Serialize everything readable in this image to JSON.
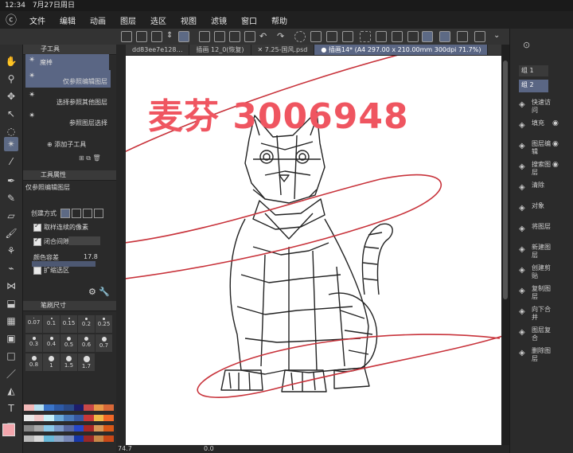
{
  "status": {
    "time": "12:34",
    "date": "7月27日周日"
  },
  "menu": {
    "items": [
      "文件",
      "编辑",
      "动画",
      "图层",
      "选区",
      "视图",
      "滤镜",
      "窗口",
      "帮助"
    ]
  },
  "tabs": [
    {
      "label": "dd83ee7e128…"
    },
    {
      "label": "插画 12_0(恢复)"
    },
    {
      "label": "✕ 7.25-国风.psd"
    },
    {
      "label": "● 插画14* (A4 297.00 x 210.00mm 300dpi 71.7%)",
      "active": true
    }
  ],
  "subtool": {
    "panel_title": "子工具",
    "items": [
      {
        "name": "魔棒",
        "label": ""
      },
      {
        "name": "",
        "label": "仅参照编辑图层"
      },
      {
        "name": "",
        "label": "选择参照其他图层"
      },
      {
        "name": "",
        "label": "参照图层选择"
      }
    ],
    "add_label": "添加子工具"
  },
  "toolprops": {
    "panel_title": "工具属性",
    "mode_title": "仅参照编辑图层",
    "create_mode_label": "创建方式",
    "contiguous_label": "取样连续的像素",
    "close_gap_label": "闭合间隙",
    "tolerance_label": "颜色容差",
    "tolerance_value": "17.8",
    "expand_label": "扩缩选区"
  },
  "brushsize": {
    "panel_title": "笔刷尺寸",
    "sizes": [
      "0.07",
      "0.1",
      "0.15",
      "0.2",
      "0.25",
      "0.3",
      "0.4",
      "0.5",
      "0.6",
      "0.7",
      "0.8",
      "1",
      "1.5",
      "1.7"
    ]
  },
  "swatch_colors": [
    "#f2b8b8",
    "#b7e0f0",
    "#3a74c8",
    "#2d5aa6",
    "#2a4a88",
    "#1d1d6a",
    "#c84848",
    "#e89848",
    "#d86838",
    "#e8e8e8",
    "#f0c8c8",
    "#c8f0f8",
    "#6aa8d8",
    "#4878b8",
    "#3858a0",
    "#c83838",
    "#f0b848",
    "#f06828",
    "#888888",
    "#a8a8a8",
    "#8ac8e8",
    "#7a98c8",
    "#5868a0",
    "#2848c8",
    "#a82828",
    "#d89858",
    "#d85818",
    "#b8b8b8",
    "#d8d8d8",
    "#68b8d8",
    "#90a8c8",
    "#7888b8",
    "#1838a8",
    "#982828",
    "#c88848",
    "#c84818"
  ],
  "current_color": "#f3a6ad",
  "layers": {
    "items": [
      "组 1",
      "组 2"
    ]
  },
  "right_tools": [
    "快速访问",
    "填充",
    "图层编辑",
    "搜索图层",
    "清除",
    "对象",
    "将图层",
    "新建图层",
    "创建剪贴",
    "复制图层",
    "向下合并",
    "图层复合",
    "删除图层"
  ],
  "watermark": "麦芬 3006948",
  "zoom": "74.7",
  "rotation": "0.0",
  "colors": {
    "accent": "#5d6a85",
    "watermark": "#ef5560",
    "stroke": "#c8333b"
  }
}
